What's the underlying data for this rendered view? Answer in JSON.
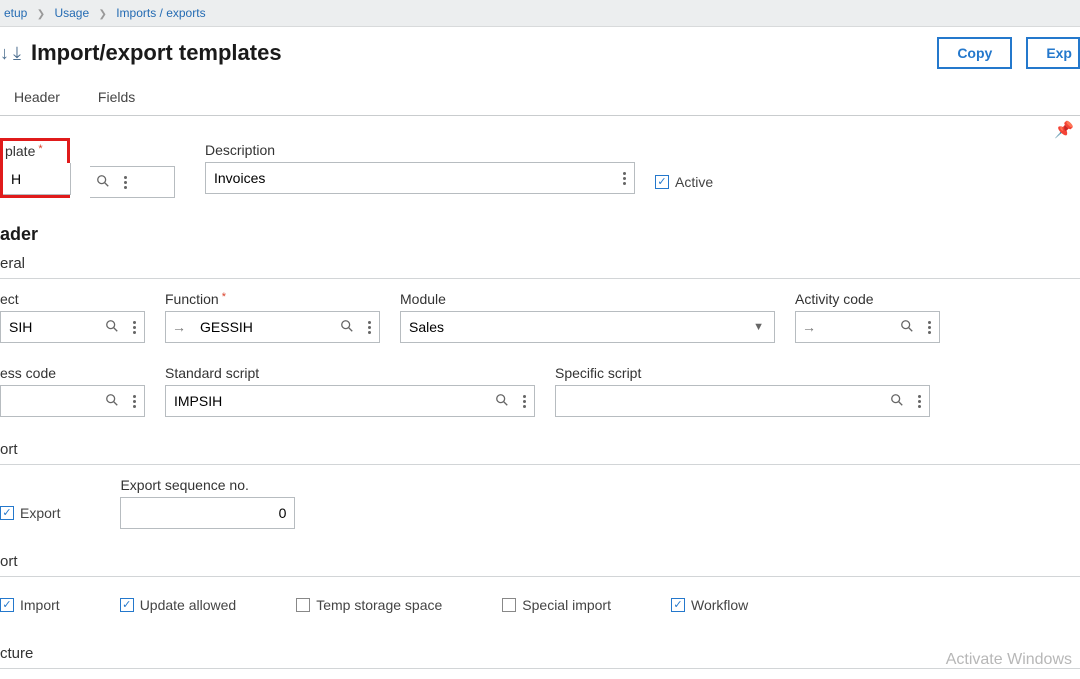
{
  "breadcrumb": {
    "setup": "etup",
    "usage": "Usage",
    "imports": "Imports / exports"
  },
  "title": "Import/export templates",
  "buttons": {
    "copy": "Copy",
    "exp": "Exp"
  },
  "tabs": {
    "header": "Header",
    "fields": "Fields"
  },
  "top": {
    "template_label": "plate",
    "template_value": "H",
    "description_label": "Description",
    "description_value": "Invoices",
    "active_label": "Active"
  },
  "header_section": "ader",
  "general_label": "eral",
  "general": {
    "object_label": "ect",
    "object_value": "SIH",
    "function_label": "Function",
    "function_value": "GESSIH",
    "module_label": "Module",
    "module_value": "Sales",
    "activity_label": "Activity code",
    "access_label": "ess code",
    "std_script_label": "Standard script",
    "std_script_value": "IMPSIH",
    "spec_script_label": "Specific script"
  },
  "export_label": "ort",
  "export": {
    "export_cb": "Export",
    "seq_label": "Export sequence no.",
    "seq_value": "0"
  },
  "import_label": "ort",
  "import": {
    "import_cb": "Import",
    "update": "Update allowed",
    "temp": "Temp storage space",
    "special": "Special import",
    "workflow": "Workflow"
  },
  "structure_label": "cture",
  "watermark": "Activate Windows"
}
